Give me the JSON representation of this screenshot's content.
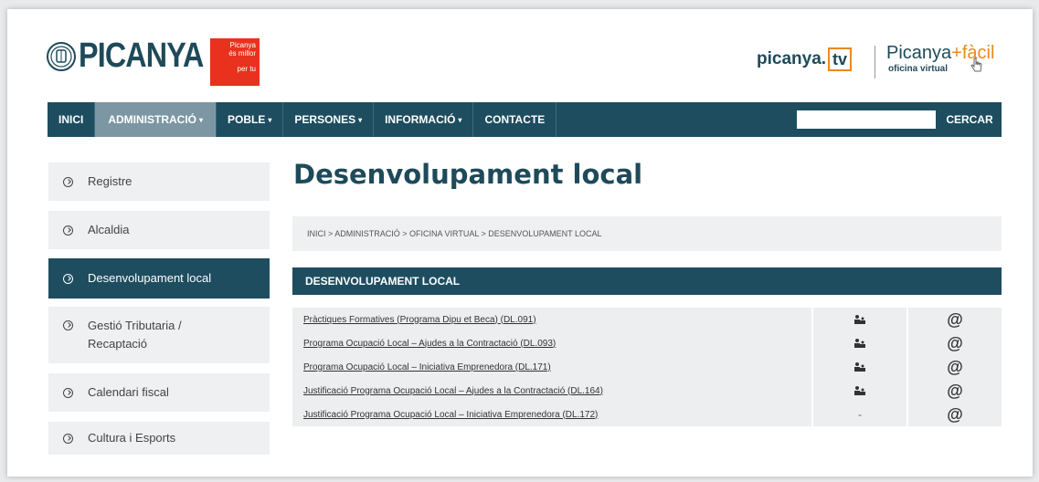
{
  "header": {
    "logo_text": "PICANYA",
    "badge_lines": [
      "Picanya",
      "és millor",
      "per tu"
    ],
    "tv_text": "picanya.",
    "tv_box": "tv",
    "pf_title": "Picanya",
    "pf_plus": "+fàcil",
    "pf_sub": "oficina virtual"
  },
  "nav": {
    "items": [
      {
        "label": "INICI",
        "caret": ""
      },
      {
        "label": "ADMINISTRACIÓ",
        "caret": "▾"
      },
      {
        "label": "POBLE",
        "caret": "▾"
      },
      {
        "label": "PERSONES",
        "caret": "▾"
      },
      {
        "label": "INFORMACIÓ",
        "caret": "▾"
      },
      {
        "label": "CONTACTE",
        "caret": ""
      }
    ],
    "search_value": "",
    "search_button": "CERCAR"
  },
  "sidebar": {
    "items": [
      {
        "label": "Registre"
      },
      {
        "label": "Alcaldia"
      },
      {
        "label": "Desenvolupament local"
      },
      {
        "label": "Gestió Tributaria / Recaptació"
      },
      {
        "label": "Calendari fiscal"
      },
      {
        "label": "Cultura i Esports"
      }
    ]
  },
  "main": {
    "title": "Desenvolupament local",
    "breadcrumb": "INICI > ADMINISTRACIÓ > OFICINA VIRTUAL > DESENVOLUPAMENT LOCAL",
    "section_header": "DESENVOLUPAMENT LOCAL",
    "rows": [
      {
        "label": "Pràctiques Formatives (Programa Dipu et Beca) (DL.091)",
        "presencial": "icon",
        "online": "@"
      },
      {
        "label": "Programa Ocupació Local – Ajudes a la Contractació (DL.093)",
        "presencial": "icon",
        "online": "@"
      },
      {
        "label": "Programa Ocupació Local – Iniciativa Emprenedora (DL.171)",
        "presencial": "icon",
        "online": "@"
      },
      {
        "label": "Justificació Programa Ocupació Local – Ajudes a la Contractació (DL.164)",
        "presencial": "icon",
        "online": "@"
      },
      {
        "label": "Justificació Programa Ocupació Local – Iniciativa Emprenedora (DL.172)",
        "presencial": "-",
        "online": "@"
      }
    ]
  },
  "colors": {
    "brand_dark": "#1e4d5f",
    "nav_active": "#7c97a3",
    "badge_red": "#e8321e",
    "accent_orange": "#e88a1e"
  }
}
